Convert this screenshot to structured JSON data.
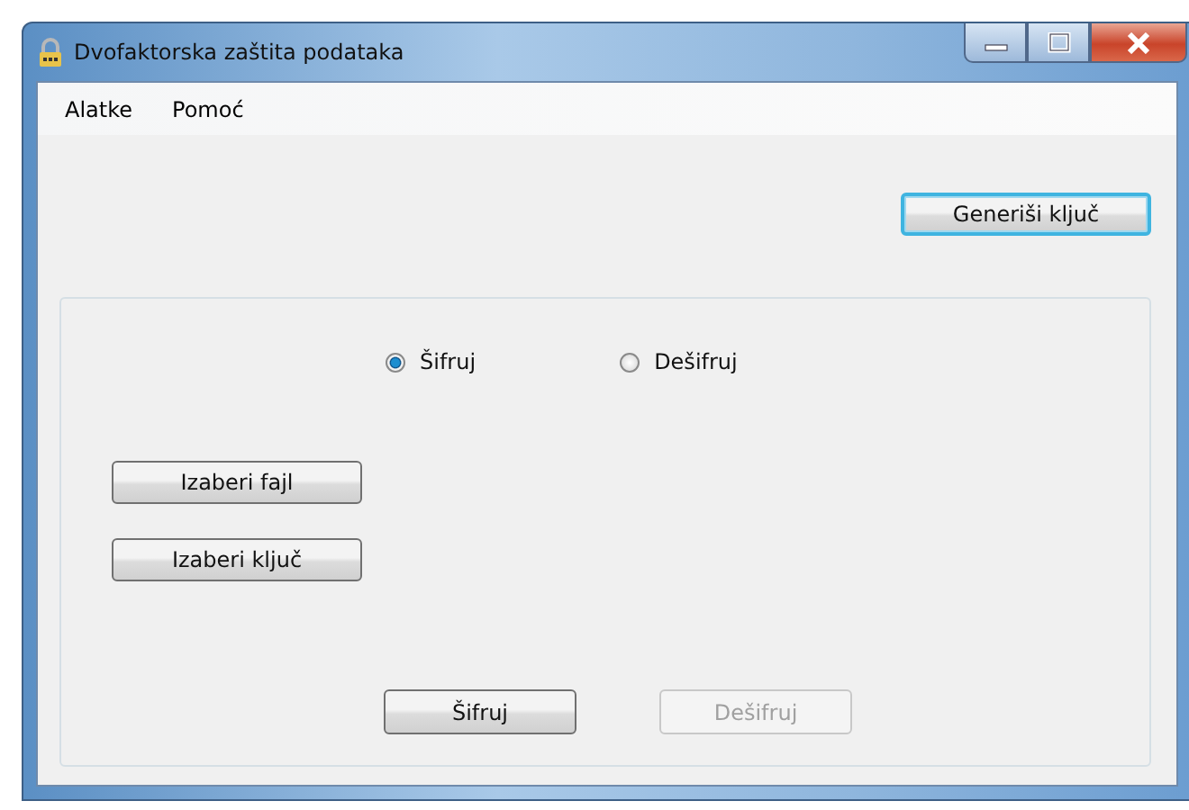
{
  "window": {
    "title": "Dvofaktorska zaštita podataka"
  },
  "menu": [
    {
      "label": "Alatke"
    },
    {
      "label": "Pomoć"
    }
  ],
  "generate_button": {
    "label": "Generiši ključ",
    "focused": true
  },
  "mode_radios": [
    {
      "label": "Šifruj",
      "selected": true
    },
    {
      "label": "Dešifruj",
      "selected": false
    }
  ],
  "file_buttons": [
    {
      "label": "Izaberi fajl",
      "disabled": false
    },
    {
      "label": "Izaberi ključ",
      "disabled": false
    }
  ],
  "action_buttons": [
    {
      "label": "Šifruj",
      "disabled": false
    },
    {
      "label": "Dešifruj",
      "disabled": true
    }
  ]
}
